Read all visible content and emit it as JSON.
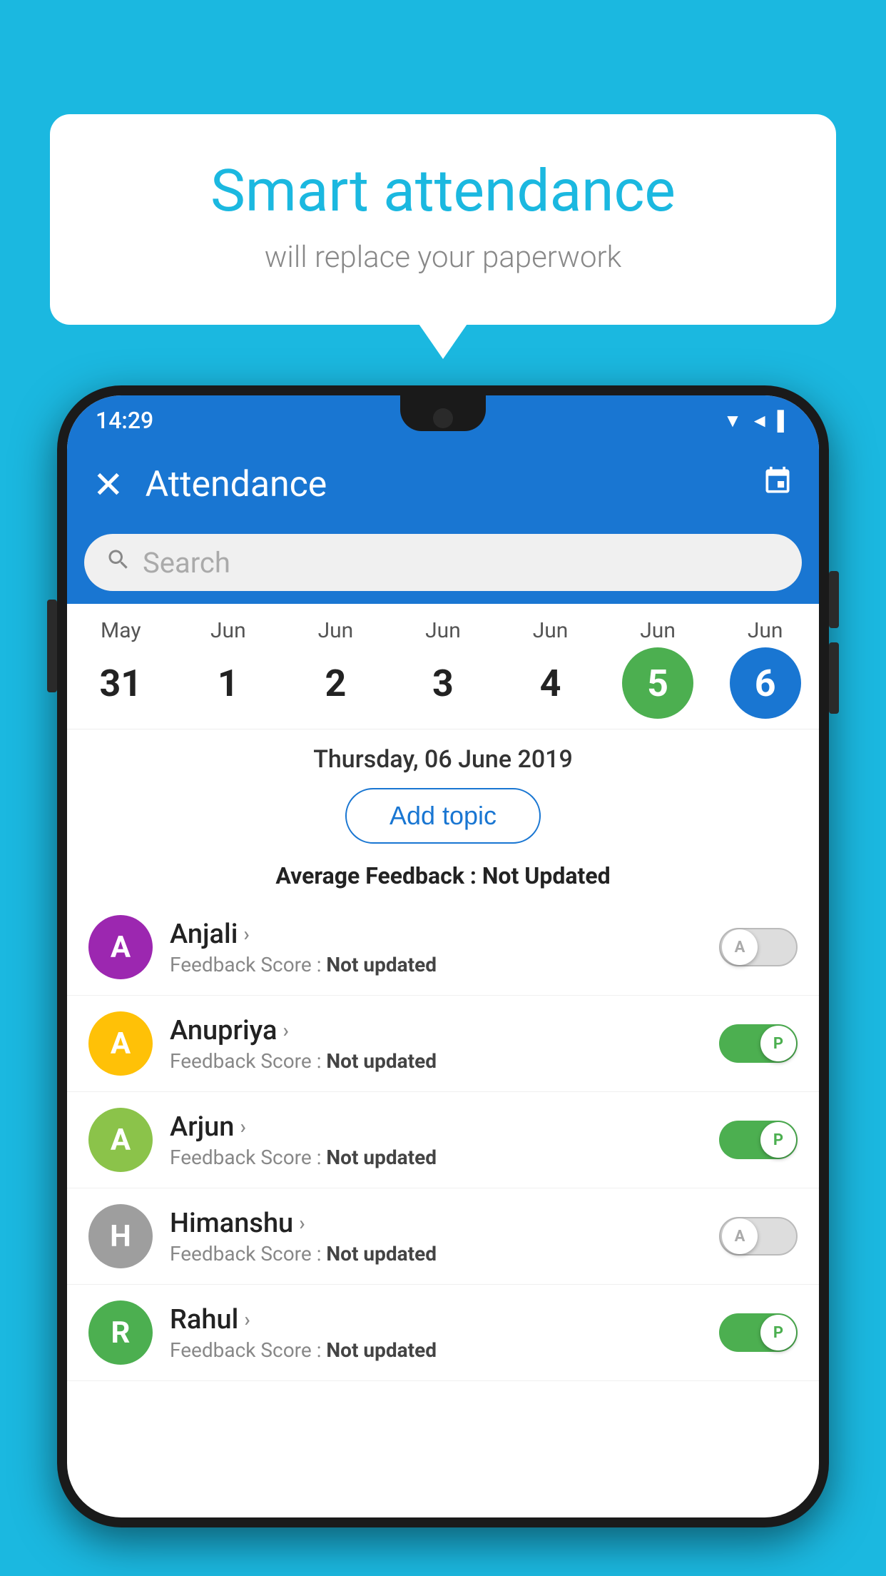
{
  "bubble": {
    "title": "Smart attendance",
    "subtitle": "will replace your paperwork"
  },
  "status_bar": {
    "time": "14:29"
  },
  "app_bar": {
    "title": "Attendance",
    "close_label": "✕",
    "calendar_icon": "📅"
  },
  "search": {
    "placeholder": "Search"
  },
  "calendar": {
    "days": [
      {
        "month": "May",
        "date": "31",
        "state": "normal"
      },
      {
        "month": "Jun",
        "date": "1",
        "state": "normal"
      },
      {
        "month": "Jun",
        "date": "2",
        "state": "normal"
      },
      {
        "month": "Jun",
        "date": "3",
        "state": "normal"
      },
      {
        "month": "Jun",
        "date": "4",
        "state": "normal"
      },
      {
        "month": "Jun",
        "date": "5",
        "state": "today"
      },
      {
        "month": "Jun",
        "date": "6",
        "state": "selected"
      }
    ]
  },
  "selected_date": "Thursday, 06 June 2019",
  "add_topic_label": "Add topic",
  "avg_feedback_label": "Average Feedback : ",
  "avg_feedback_value": "Not Updated",
  "students": [
    {
      "name": "Anjali",
      "avatar_letter": "A",
      "avatar_color": "#9C27B0",
      "feedback": "Feedback Score : ",
      "feedback_value": "Not updated",
      "toggle": "off",
      "toggle_label": "A"
    },
    {
      "name": "Anupriya",
      "avatar_letter": "A",
      "avatar_color": "#FFC107",
      "feedback": "Feedback Score : ",
      "feedback_value": "Not updated",
      "toggle": "on",
      "toggle_label": "P"
    },
    {
      "name": "Arjun",
      "avatar_letter": "A",
      "avatar_color": "#8BC34A",
      "feedback": "Feedback Score : ",
      "feedback_value": "Not updated",
      "toggle": "on",
      "toggle_label": "P"
    },
    {
      "name": "Himanshu",
      "avatar_letter": "H",
      "avatar_color": "#9E9E9E",
      "feedback": "Feedback Score : ",
      "feedback_value": "Not updated",
      "toggle": "off",
      "toggle_label": "A"
    },
    {
      "name": "Rahul",
      "avatar_letter": "R",
      "avatar_color": "#4CAF50",
      "feedback": "Feedback Score : ",
      "feedback_value": "Not updated",
      "toggle": "on",
      "toggle_label": "P"
    }
  ]
}
